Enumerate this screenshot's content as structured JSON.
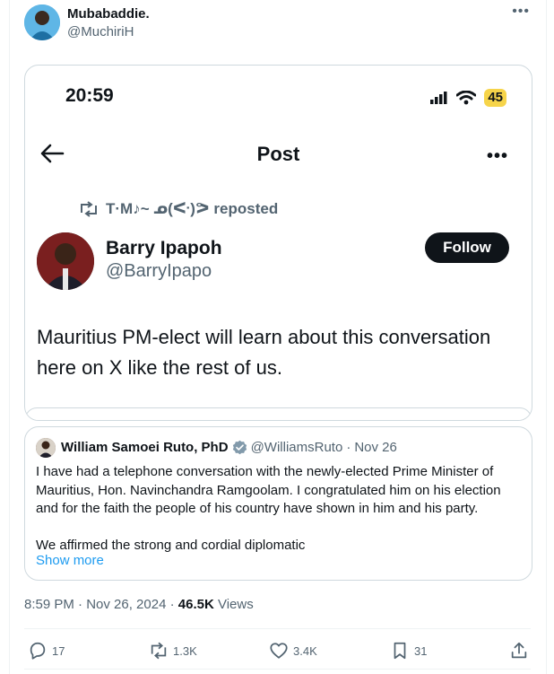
{
  "author": {
    "display_name": "Mubabaddie.",
    "handle": "@MuchiriH"
  },
  "screenshot": {
    "time": "20:59",
    "battery": "45",
    "header_title": "Post",
    "repost_line": "T·M♪~ ᓄ(ᑅ)ᕗ reposted",
    "post_author": {
      "name": "Barry Ipapoh",
      "handle": "@BarryIpapo"
    },
    "follow_label": "Follow",
    "post_text": "Mauritius PM-elect will learn about this conversation here on X like the rest of us."
  },
  "quote": {
    "name": "William Samoei Ruto, PhD",
    "handle": "@WilliamsRuto",
    "separator": "·",
    "date": "Nov 26",
    "paragraph1": "I have had a telephone conversation with the newly-elected Prime Minister of Mauritius, Hon. Navinchandra Ramgoolam. I congratulated him on his election and for the faith the people of his country have shown in him and his party.",
    "paragraph2": "We affirmed the strong and cordial diplomatic",
    "show_more": "Show more"
  },
  "meta": {
    "time_date": "8:59 PM · Nov 26, 2024 · ",
    "views_count": "46.5K",
    "views_label": " Views"
  },
  "actions": {
    "replies": "17",
    "reposts": "1.3K",
    "likes": "3.4K",
    "bookmarks": "31"
  },
  "colors": {
    "accent": "#1d9bf0",
    "text": "#0f1419",
    "secondary": "#536471",
    "battery": "#f6d44a"
  }
}
